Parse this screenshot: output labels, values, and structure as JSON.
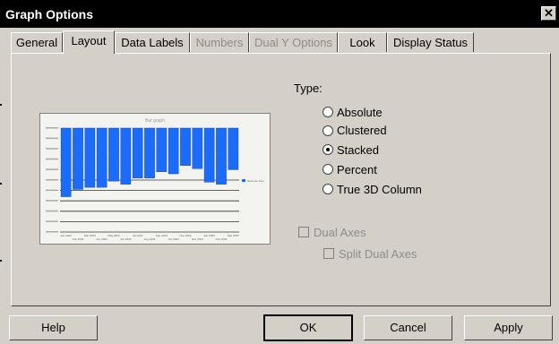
{
  "window": {
    "title": "Graph Options",
    "close_glyph": "✕"
  },
  "tabs": [
    {
      "label": "General",
      "enabled": true
    },
    {
      "label": "Layout",
      "enabled": true,
      "selected": true
    },
    {
      "label": "Data Labels",
      "enabled": true
    },
    {
      "label": "Numbers",
      "enabled": false
    },
    {
      "label": "Dual Y Options",
      "enabled": false
    },
    {
      "label": "Look",
      "enabled": true
    },
    {
      "label": "Display Status",
      "enabled": true
    }
  ],
  "type_section": {
    "label": "Type:",
    "options": [
      {
        "label": "Absolute",
        "checked": false
      },
      {
        "label": "Clustered",
        "checked": false
      },
      {
        "label": "Stacked",
        "checked": true
      },
      {
        "label": "Percent",
        "checked": false
      },
      {
        "label": "True 3D Column",
        "checked": false
      }
    ]
  },
  "dual_axes": {
    "label": "Dual Axes",
    "checked": false,
    "enabled": false
  },
  "split_dual_axes": {
    "label": "Split Dual Axes",
    "checked": false,
    "enabled": false
  },
  "buttons": {
    "help": "Help",
    "ok": "OK",
    "cancel": "Cancel",
    "apply": "Apply"
  },
  "preview": {
    "title": "Bar graph",
    "bar_color": "#1a6cff",
    "legend_label": "Revenue Sum",
    "x_labels_top": [
      "Jan 2004",
      "Mar 2004",
      "May 2004",
      "Jul 2004",
      "Sep 2004",
      "Nov 2004",
      "Jan 2005",
      "Mar 2005"
    ],
    "x_labels_bottom": [
      "Feb 2004",
      "Apr 2004",
      "Jun 2004",
      "Aug 2004",
      "Oct 2004",
      "Dec 2004",
      "Feb 2005"
    ]
  },
  "chart_data": {
    "type": "bar",
    "title": "Bar graph",
    "categories": [
      "Jan 2004",
      "Feb 2004",
      "Mar 2004",
      "Apr 2004",
      "May 2004",
      "Jun 2004",
      "Jul 2004",
      "Aug 2004",
      "Sep 2004",
      "Oct 2004",
      "Nov 2004",
      "Dec 2004",
      "Jan 2005",
      "Feb 2005",
      "Mar 2005"
    ],
    "series": [
      {
        "name": "Revenue Sum",
        "values": [
          66,
          59,
          57,
          57,
          51,
          54,
          48,
          48,
          42,
          44,
          36,
          39,
          52,
          54,
          40
        ]
      }
    ],
    "ylim": [
      0,
      100
    ],
    "legend": "right",
    "grid": true
  }
}
